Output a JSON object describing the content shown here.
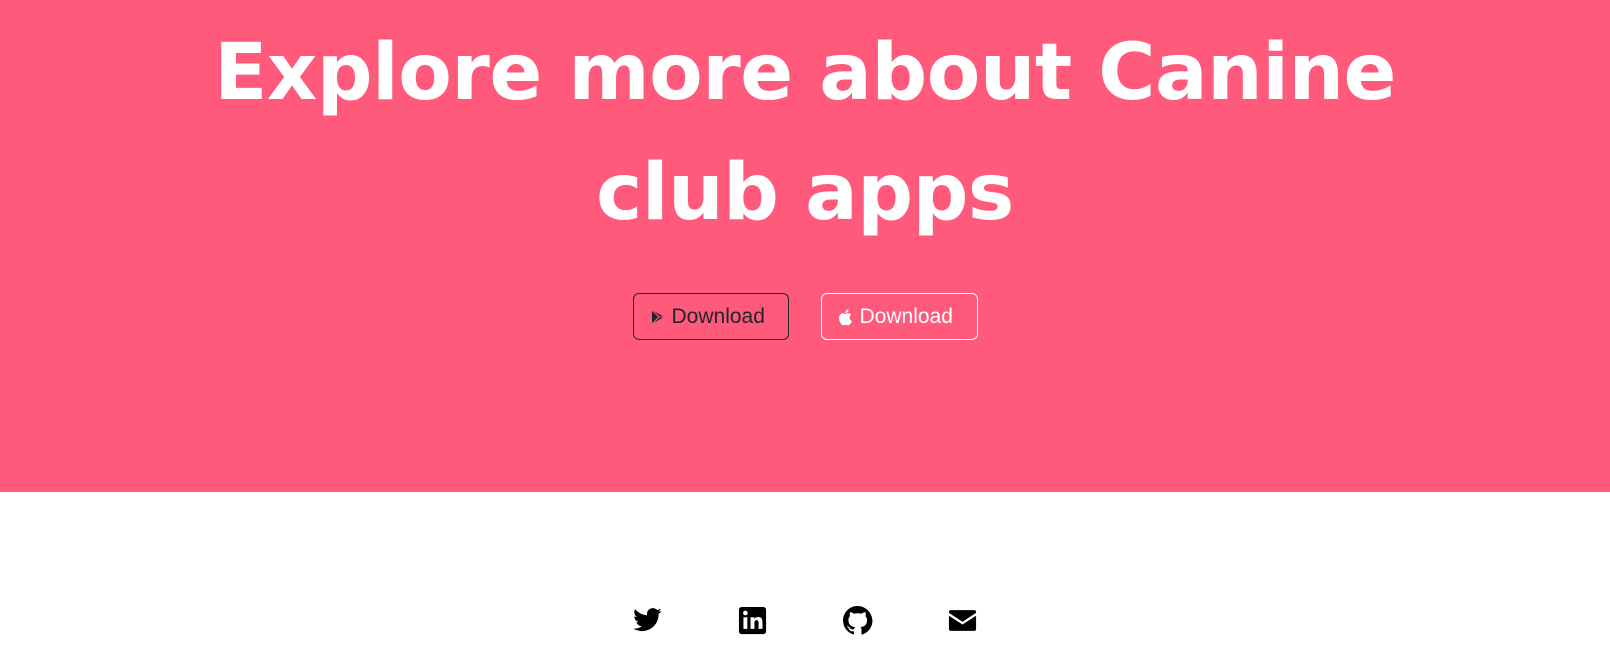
{
  "colors": {
    "hero_bg": "#ff5a7c",
    "dark_text": "#212529",
    "white": "#ffffff"
  },
  "hero": {
    "headline_line1": "Explore more about Canine",
    "headline_line2": "club apps",
    "buttons": [
      {
        "label": "Download",
        "icon": "google-play-icon"
      },
      {
        "label": "Download",
        "icon": "apple-icon"
      }
    ]
  },
  "footer": {
    "social_links": [
      {
        "icon": "twitter-icon"
      },
      {
        "icon": "linkedin-icon"
      },
      {
        "icon": "github-icon"
      },
      {
        "icon": "email-icon"
      }
    ]
  }
}
